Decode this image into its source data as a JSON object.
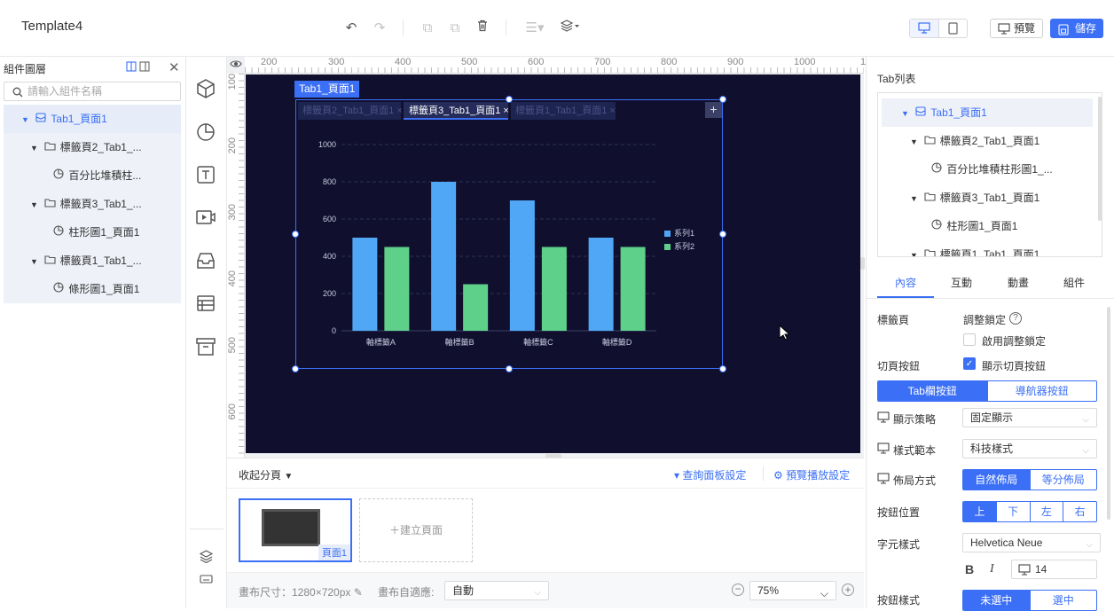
{
  "app": {
    "title": "Template4"
  },
  "header": {
    "preview_label": "預覽",
    "save_label": "儲存"
  },
  "left_panel": {
    "title": "組件圖層",
    "search_placeholder": "請輸入組件名稱",
    "tree": [
      {
        "label": "Tab1_頁面1",
        "level": 0
      },
      {
        "label": "標籤頁2_Tab1_...",
        "level": 1
      },
      {
        "label": "百分比堆積柱...",
        "level": 2
      },
      {
        "label": "標籤頁3_Tab1_...",
        "level": 1
      },
      {
        "label": "柱形圖1_頁面1",
        "level": 2
      },
      {
        "label": "標籤頁1_Tab1_...",
        "level": 1
      },
      {
        "label": "條形圖1_頁面1",
        "level": 2
      }
    ]
  },
  "ruler": {
    "h": [
      "200",
      "300",
      "400",
      "500",
      "600",
      "700",
      "800",
      "900",
      "1000",
      "1"
    ],
    "v": [
      "100",
      "200",
      "300",
      "400",
      "500",
      "600"
    ]
  },
  "widget": {
    "label": "Tab1_頁面1",
    "tabs": [
      "標籤頁2_Tab1_頁面1",
      "標籤頁3_Tab1_頁面1",
      "標籤頁1_Tab1_頁面1"
    ],
    "active_tab": 1
  },
  "chart_data": {
    "type": "bar",
    "categories": [
      "軸標籤A",
      "軸標籤B",
      "軸標籤C",
      "軸標籤D"
    ],
    "series": [
      {
        "name": "系列1",
        "values": [
          500,
          800,
          700,
          500
        ],
        "color": "#4fa7f5"
      },
      {
        "name": "系列2",
        "values": [
          450,
          250,
          450,
          450
        ],
        "color": "#5fd08a"
      }
    ],
    "yticks": [
      "0",
      "200",
      "400",
      "600",
      "800",
      "1000"
    ],
    "ylim": [
      0,
      1000
    ],
    "grid": true,
    "legend": "right"
  },
  "bottom": {
    "collapse_label": "收起分頁",
    "query_settings": "查詢面板設定",
    "preview_settings": "預覽播放設定",
    "page_label": "頁面1",
    "new_page": "建立頁面",
    "canvas_size_label": "畫布尺寸：1280×720px",
    "fit_label": "畫布自適應:",
    "fit_value": "自動",
    "zoom": "75%"
  },
  "right_panel": {
    "tab_list_title": "Tab列表",
    "tree": [
      {
        "label": "Tab1_頁面1",
        "level": 0
      },
      {
        "label": "標籤頁2_Tab1_頁面1",
        "level": 1
      },
      {
        "label": "百分比堆積柱形圖1_...",
        "level": 2
      },
      {
        "label": "標籤頁3_Tab1_頁面1",
        "level": 1
      },
      {
        "label": "柱形圖1_頁面1",
        "level": 2
      },
      {
        "label": "標籤頁1_Tab1_頁面1",
        "level": 1
      }
    ],
    "tabs": [
      "內容",
      "互動",
      "動畫",
      "組件"
    ],
    "active_tab": 0,
    "tab_page_label": "標籤頁",
    "lock_label": "調整鎖定",
    "enable_lock": "啟用調整鎖定",
    "switch_button_label": "切頁按鈕",
    "show_switch": "顯示切頁按鈕",
    "button_type": [
      "Tab欄按鈕",
      "導航器按鈕"
    ],
    "display_strategy_label": "顯示策略",
    "display_strategy_value": "固定顯示",
    "style_label": "樣式範本",
    "style_value": "科技樣式",
    "layout_label": "佈局方式",
    "layout_options": [
      "自然佈局",
      "等分佈局"
    ],
    "position_label": "按鈕位置",
    "position_options": [
      "上",
      "下",
      "左",
      "右"
    ],
    "font_label": "字元樣式",
    "font_value": "Helvetica Neue",
    "font_size": "14",
    "button_style_label": "按鈕樣式",
    "button_style_options": [
      "未選中",
      "選中"
    ]
  }
}
